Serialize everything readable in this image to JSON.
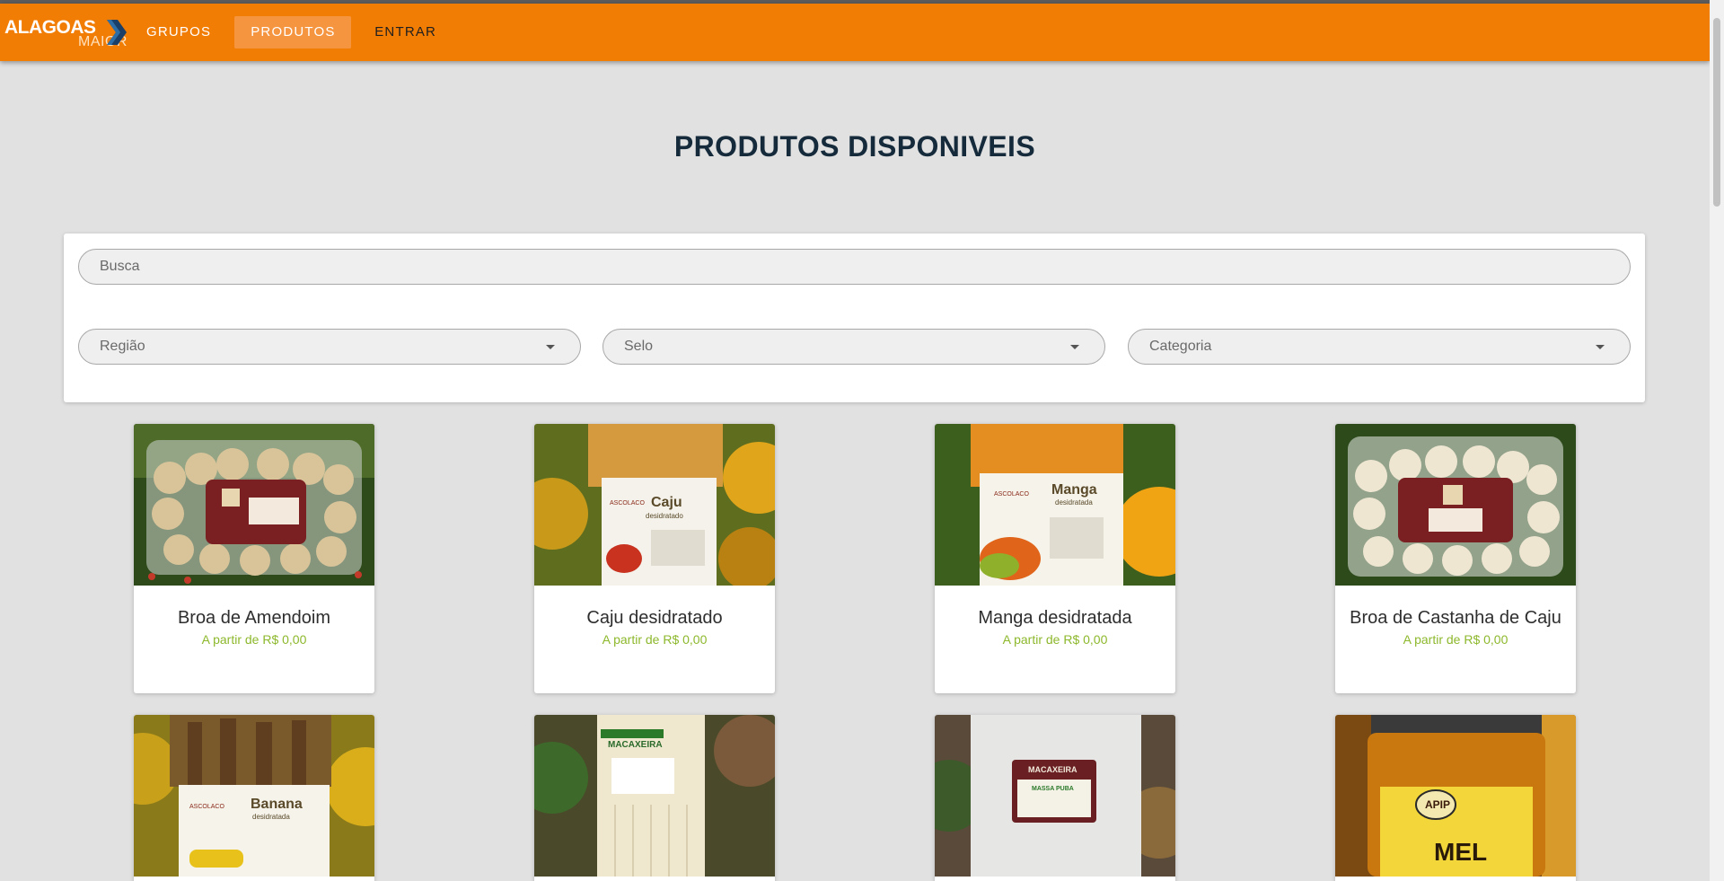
{
  "brand": {
    "name_top": "ALAGOAS",
    "name_bottom": "MAIOR"
  },
  "nav": {
    "items": [
      "GRUPOS",
      "PRODUTOS",
      "ENTRAR"
    ],
    "active": "PRODUTOS"
  },
  "page": {
    "title": "PRODUTOS DISPONIVEIS"
  },
  "filters": {
    "search_placeholder": "Busca",
    "region": "Região",
    "seal": "Selo",
    "category": "Categoria"
  },
  "products": [
    {
      "name": "Broa de Amendoim",
      "price": "A partir de R$ 0,00",
      "image": "broa-amendoim-photo"
    },
    {
      "name": "Caju desidratado",
      "price": "A partir de R$ 0,00",
      "image": "caju-photo"
    },
    {
      "name": "Manga desidratada",
      "price": "A partir de R$ 0,00",
      "image": "manga-photo"
    },
    {
      "name": "Broa de Castanha de Caju",
      "price": "A partir de R$ 0,00",
      "image": "broa-castanha-photo"
    },
    {
      "name": "",
      "price": "",
      "image": "banana-photo"
    },
    {
      "name": "",
      "price": "",
      "image": "macaxeira-photo"
    },
    {
      "name": "",
      "price": "",
      "image": "massa-puba-photo"
    },
    {
      "name": "",
      "price": "",
      "image": "mel-photo"
    }
  ],
  "colors": {
    "nav_bg": "#f27d05",
    "price": "#8db82c",
    "title": "#152a3b",
    "page_bg": "#e1e1e1"
  }
}
